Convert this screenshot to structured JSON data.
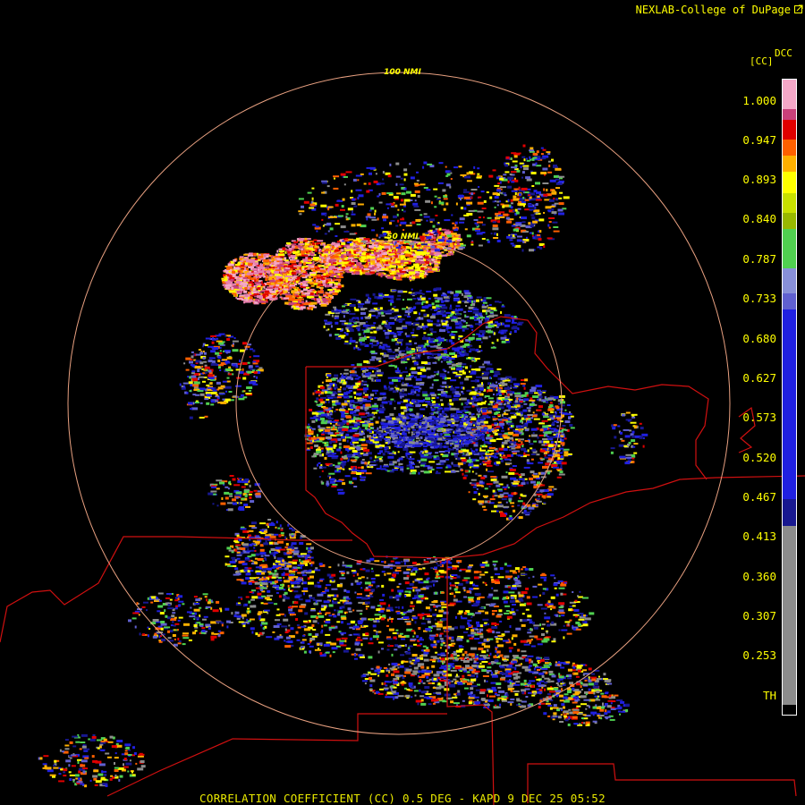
{
  "credit": "NEXLAB-College of DuPage",
  "title": "CORRELATION COEFFICIENT (CC) 0.5 DEG - KAPD 9 DEC 25 05:52",
  "range_rings": [
    {
      "label": "100 NMI"
    },
    {
      "label": "50 NMI"
    }
  ],
  "legend": {
    "product": "DCC",
    "unit": "[CC]",
    "ticks": [
      "1.000",
      "0.947",
      "0.893",
      "0.840",
      "0.787",
      "0.733",
      "0.680",
      "0.627",
      "0.573",
      "0.520",
      "0.467",
      "0.413",
      "0.360",
      "0.307",
      "0.253",
      "TH"
    ],
    "colors": {
      "pink_light": "#f4a8c8",
      "pink": "#e87fae",
      "magenta": "#c8407a",
      "red": "#e00000",
      "orange": "#ff6000",
      "amber": "#ffb000",
      "yellow": "#ffff00",
      "yellow_green": "#c8e000",
      "olive": "#98b800",
      "green": "#50d050",
      "lavender": "#8890d8",
      "periwinkle": "#6060d0",
      "blue": "#2020e0",
      "navy": "#181890",
      "gray": "#8c8c8c",
      "black": "#000000"
    }
  },
  "boundary_color": "#d01010",
  "ring_color": "#e8a080"
}
